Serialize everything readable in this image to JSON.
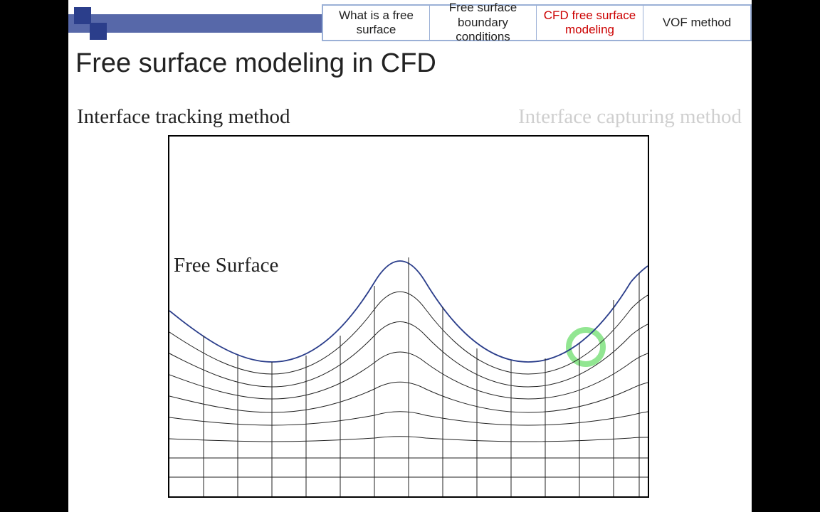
{
  "tabs": {
    "t1": "What is a free surface",
    "t2": "Free surface boundary conditions",
    "t3": "CFD free surface modeling",
    "t4": "VOF method"
  },
  "title": "Free surface modeling in CFD",
  "methods": {
    "left": "Interface tracking method",
    "right": "Interface capturing method"
  },
  "diagram": {
    "free_surface_label": "Free Surface"
  }
}
